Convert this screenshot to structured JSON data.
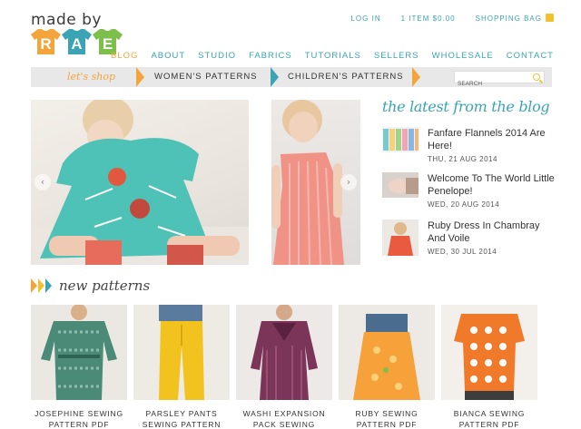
{
  "brand": {
    "line1": "made by",
    "letters": [
      "R",
      "A",
      "E"
    ],
    "letter_colors": [
      "#f3a43a",
      "#3aa4b4",
      "#7cbf4a"
    ]
  },
  "toplinks": {
    "login": "LOG IN",
    "cart": "1 ITEM $0.00",
    "bag": "SHOPPING BAG"
  },
  "nav": [
    "BLOG",
    "ABOUT",
    "STUDIO",
    "FABRICS",
    "TUTORIALS",
    "SELLERS",
    "WHOLESALE",
    "CONTACT"
  ],
  "nav_active": "BLOG",
  "shopbar": {
    "label": "let's shop",
    "women": "WOMEN'S PATTERNS",
    "children": "CHILDREN'S PATTERNS",
    "search_placeholder": "SEARCH"
  },
  "blog": {
    "heading": "the latest from the blog",
    "posts": [
      {
        "title": "Fanfare Flannels 2014 Are Here!",
        "date": "THU, 21 AUG 2014"
      },
      {
        "title": "Welcome To The World Little Penelope!",
        "date": "WED, 20 AUG 2014"
      },
      {
        "title": "Ruby Dress In Chambray And Voile",
        "date": "WED, 30 JUL 2014"
      }
    ]
  },
  "new_patterns": {
    "heading": "new patterns",
    "items": [
      {
        "name": "JOSEPHINE SEWING PATTERN PDF"
      },
      {
        "name": "PARSLEY PANTS SEWING PATTERN"
      },
      {
        "name": "WASHI EXPANSION PACK SEWING"
      },
      {
        "name": "RUBY SEWING PATTERN PDF"
      },
      {
        "name": "BIANCA SEWING PATTERN PDF"
      }
    ]
  },
  "colors": {
    "teal": "#3aa4b4",
    "orange": "#f3a43a",
    "yellow": "#f2c12e",
    "green": "#7cbf4a"
  }
}
